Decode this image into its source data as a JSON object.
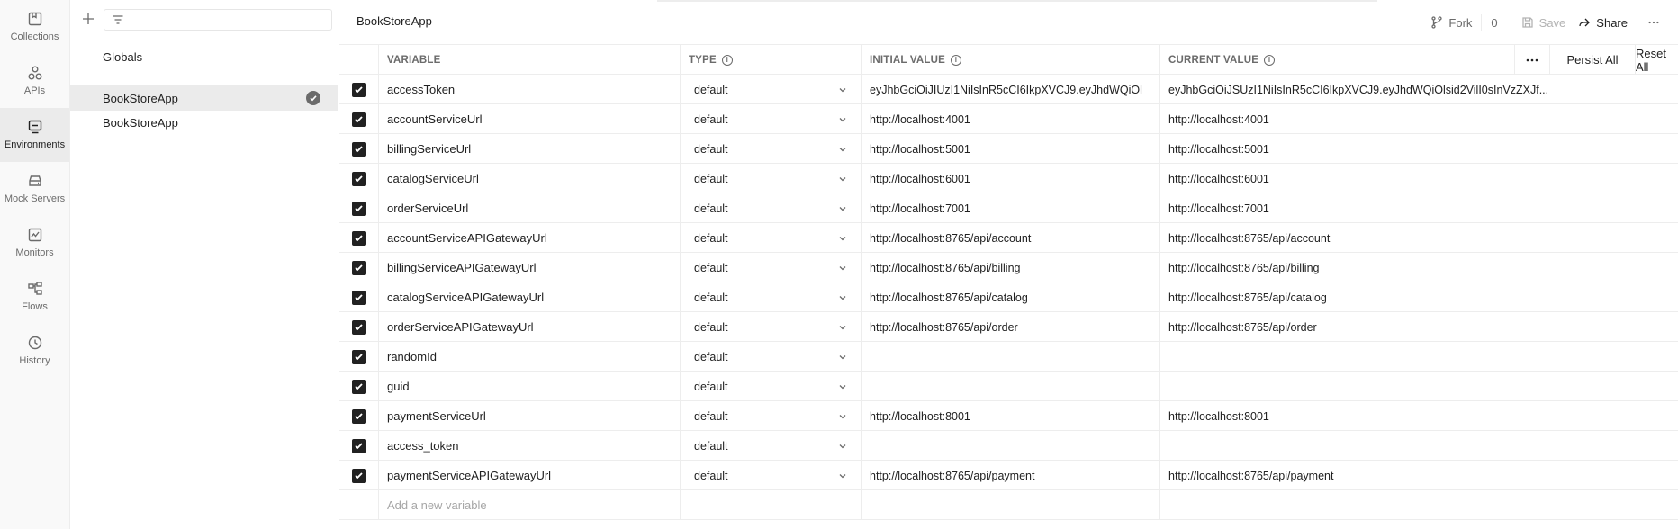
{
  "rail": [
    {
      "label": "Collections",
      "icon": "collections-icon"
    },
    {
      "label": "APIs",
      "icon": "apis-icon"
    },
    {
      "label": "Environments",
      "icon": "environments-icon"
    },
    {
      "label": "Mock Servers",
      "icon": "mock-servers-icon"
    },
    {
      "label": "Monitors",
      "icon": "monitors-icon"
    },
    {
      "label": "Flows",
      "icon": "flows-icon"
    },
    {
      "label": "History",
      "icon": "history-icon"
    }
  ],
  "envbar": {
    "filter_placeholder": "",
    "globals_label": "Globals",
    "environments": [
      {
        "name": "BookStoreApp",
        "active": true
      },
      {
        "name": "BookStoreApp",
        "active": false
      }
    ]
  },
  "header": {
    "title": "BookStoreApp",
    "fork_label": "Fork",
    "fork_count": "0",
    "save_label": "Save",
    "share_label": "Share"
  },
  "table": {
    "headers": {
      "variable": "VARIABLE",
      "type": "TYPE",
      "initial": "INITIAL VALUE",
      "current": "CURRENT VALUE"
    },
    "persist_all": "Persist All",
    "reset_all": "Reset All",
    "add_placeholder": "Add a new variable",
    "rows": [
      {
        "name": "accessToken",
        "type": "default",
        "initial": "eyJhbGciOiJIUzI1NiIsInR5cCI6IkpXVCJ9.eyJhdWQiOl",
        "current": "eyJhbGciOiJSUzI1NiIsInR5cCI6IkpXVCJ9.eyJhdWQiOlsid2VilI0sInVzZXJf..."
      },
      {
        "name": "accountServiceUrl",
        "type": "default",
        "initial": "http://localhost:4001",
        "current": "http://localhost:4001"
      },
      {
        "name": "billingServiceUrl",
        "type": "default",
        "initial": "http://localhost:5001",
        "current": "http://localhost:5001"
      },
      {
        "name": "catalogServiceUrl",
        "type": "default",
        "initial": "http://localhost:6001",
        "current": "http://localhost:6001"
      },
      {
        "name": "orderServiceUrl",
        "type": "default",
        "initial": "http://localhost:7001",
        "current": "http://localhost:7001"
      },
      {
        "name": "accountServiceAPIGatewayUrl",
        "type": "default",
        "initial": "http://localhost:8765/api/account",
        "current": "http://localhost:8765/api/account"
      },
      {
        "name": "billingServiceAPIGatewayUrl",
        "type": "default",
        "initial": "http://localhost:8765/api/billing",
        "current": "http://localhost:8765/api/billing"
      },
      {
        "name": "catalogServiceAPIGatewayUrl",
        "type": "default",
        "initial": "http://localhost:8765/api/catalog",
        "current": "http://localhost:8765/api/catalog"
      },
      {
        "name": "orderServiceAPIGatewayUrl",
        "type": "default",
        "initial": "http://localhost:8765/api/order",
        "current": "http://localhost:8765/api/order"
      },
      {
        "name": "randomId",
        "type": "default",
        "initial": "",
        "current": ""
      },
      {
        "name": "guid",
        "type": "default",
        "initial": "",
        "current": ""
      },
      {
        "name": "paymentServiceUrl",
        "type": "default",
        "initial": "http://localhost:8001",
        "current": "http://localhost:8001"
      },
      {
        "name": "access_token",
        "type": "default",
        "initial": "",
        "current": ""
      },
      {
        "name": "paymentServiceAPIGatewayUrl",
        "type": "default",
        "initial": "http://localhost:8765/api/payment",
        "current": "http://localhost:8765/api/payment"
      }
    ]
  },
  "colors": {
    "text": "#212121",
    "muted": "#6b6b6b",
    "border": "#ededed",
    "selected_bg": "#ebebeb"
  }
}
